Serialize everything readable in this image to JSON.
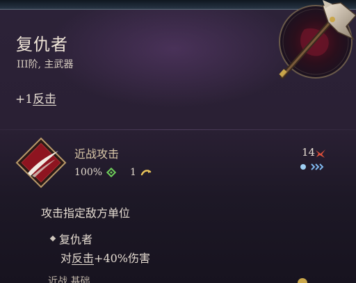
{
  "tooltip": {
    "title": "复仇者",
    "subtitle": "III阶, 主武器",
    "bonus_prefix": "+1",
    "bonus_term": "反击"
  },
  "skill": {
    "name": "近战攻击",
    "accuracy": "100%",
    "ap_cost": "1",
    "cost_value": "14",
    "description": "攻击指定敌方单位"
  },
  "passive": {
    "name": "复仇者",
    "desc_prefix": "对",
    "desc_term": "反击",
    "desc_suffix": "+40%伤害"
  },
  "tags_line": "近战  基础",
  "icons": {
    "weapon": "axe-icon",
    "skill": "slash-icon",
    "accuracy": "crosshair-icon",
    "ap": "action-point-icon",
    "cost": "red-crystal-icon",
    "charge": "charge-pips-icon"
  },
  "colors": {
    "accent_gold": "#c9a64a",
    "skill_red": "#8e1420",
    "accuracy_green": "#6fcf5a",
    "pip_blue": "#9fd0f5"
  }
}
